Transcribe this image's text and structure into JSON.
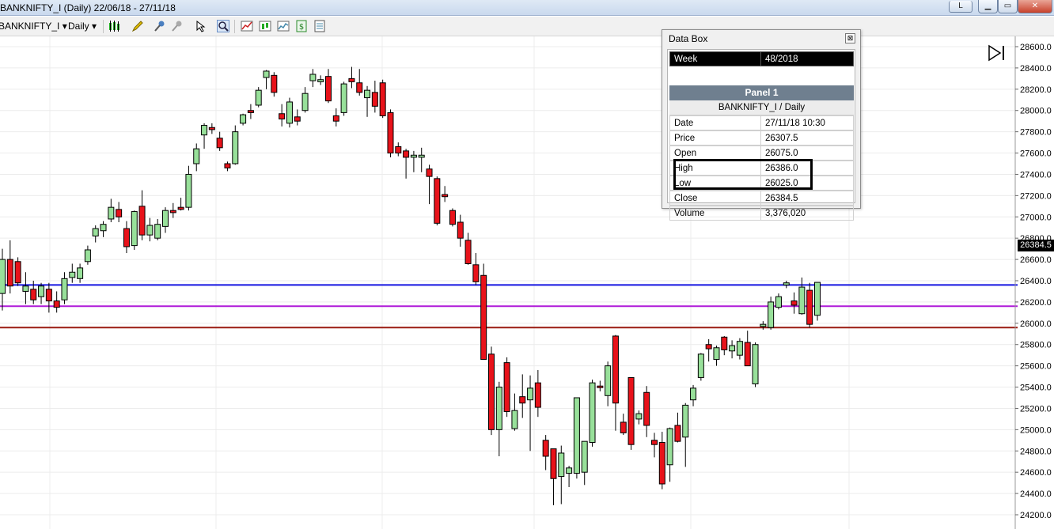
{
  "window": {
    "title": "BANKNIFTY_I (Daily)  22/06/18 - 27/11/18",
    "btn_l": "L",
    "btn_min": "▁",
    "btn_max": "▭",
    "btn_close": "✕"
  },
  "toolbar": {
    "instrument": "BANKNIFTY_I",
    "interval": "Daily",
    "dropdown_arrow": "▾",
    "icons": [
      "candle-style-icon",
      "draw-pencil-icon",
      "pin-icon",
      "magnet-icon",
      "cursor-icon",
      "zoom-icon",
      "indicators-icon",
      "strategies-icon",
      "chart-properties-icon",
      "dollar-icon",
      "data-box-icon"
    ]
  },
  "databox": {
    "title": "Data Box",
    "close": "⊠",
    "week_label": "Week",
    "week_value": "48/2018",
    "panel": "Panel 1",
    "instrument": "BANKNIFTY_I / Daily",
    "rows": [
      {
        "k": "Date",
        "v": "27/11/18 10:30"
      },
      {
        "k": "Price",
        "v": "26307.5"
      },
      {
        "k": "Open",
        "v": "26075.0"
      },
      {
        "k": "High",
        "v": "26386.0"
      },
      {
        "k": "Low",
        "v": "26025.0"
      },
      {
        "k": "Close",
        "v": "26384.5"
      },
      {
        "k": "Volume",
        "v": "3,376,020"
      }
    ]
  },
  "last_price_label": "26384.5",
  "colors": {
    "up": "#98e09a",
    "down": "#e8121a",
    "line_blue": "#1515e0",
    "line_purple": "#b01bd8",
    "line_red": "#9a1b12"
  },
  "chart_data": {
    "type": "candlestick",
    "ylim": [
      24100,
      28700
    ],
    "y_ticks": [
      "28600.0",
      "28400.0",
      "28200.0",
      "28000.0",
      "27800.0",
      "27600.0",
      "27400.0",
      "27200.0",
      "27000.0",
      "26800.0",
      "26600.0",
      "26400.0",
      "26200.0",
      "26000.0",
      "25800.0",
      "25600.0",
      "25400.0",
      "25200.0",
      "25000.0",
      "24800.0",
      "24600.0",
      "24400.0",
      "24200.0"
    ],
    "hlines": [
      {
        "y": 26360,
        "color": "#1515e0"
      },
      {
        "y": 26160,
        "color": "#b01bd8"
      },
      {
        "y": 25960,
        "color": "#9a1b12"
      }
    ],
    "candles": [
      {
        "o": 26280,
        "h": 26700,
        "l": 26120,
        "c": 26600
      },
      {
        "o": 26600,
        "h": 26780,
        "l": 26280,
        "c": 26350
      },
      {
        "o": 26580,
        "h": 26620,
        "l": 26350,
        "c": 26380
      },
      {
        "o": 26300,
        "h": 26480,
        "l": 26180,
        "c": 26350
      },
      {
        "o": 26320,
        "h": 26400,
        "l": 26180,
        "c": 26220
      },
      {
        "o": 26250,
        "h": 26380,
        "l": 26180,
        "c": 26350
      },
      {
        "o": 26320,
        "h": 26380,
        "l": 26100,
        "c": 26210
      },
      {
        "o": 26210,
        "h": 26300,
        "l": 26100,
        "c": 26150
      },
      {
        "o": 26220,
        "h": 26480,
        "l": 26180,
        "c": 26420
      },
      {
        "o": 26430,
        "h": 26560,
        "l": 26380,
        "c": 26480
      },
      {
        "o": 26420,
        "h": 26560,
        "l": 26380,
        "c": 26520
      },
      {
        "o": 26580,
        "h": 26730,
        "l": 26550,
        "c": 26690
      },
      {
        "o": 26820,
        "h": 26920,
        "l": 26760,
        "c": 26890
      },
      {
        "o": 26870,
        "h": 26960,
        "l": 26810,
        "c": 26930
      },
      {
        "o": 26980,
        "h": 27170,
        "l": 26950,
        "c": 27090
      },
      {
        "o": 27070,
        "h": 27140,
        "l": 26950,
        "c": 27000
      },
      {
        "o": 26890,
        "h": 26960,
        "l": 26660,
        "c": 26720
      },
      {
        "o": 26730,
        "h": 27060,
        "l": 26690,
        "c": 27050
      },
      {
        "o": 27100,
        "h": 27250,
        "l": 26780,
        "c": 26830
      },
      {
        "o": 26830,
        "h": 26990,
        "l": 26770,
        "c": 26920
      },
      {
        "o": 26800,
        "h": 26980,
        "l": 26780,
        "c": 26930
      },
      {
        "o": 26910,
        "h": 27090,
        "l": 26850,
        "c": 27060
      },
      {
        "o": 27060,
        "h": 27130,
        "l": 26990,
        "c": 27040
      },
      {
        "o": 27090,
        "h": 27180,
        "l": 27060,
        "c": 27070
      },
      {
        "o": 27090,
        "h": 27480,
        "l": 27060,
        "c": 27400
      },
      {
        "o": 27500,
        "h": 27690,
        "l": 27430,
        "c": 27640
      },
      {
        "o": 27770,
        "h": 27880,
        "l": 27640,
        "c": 27860
      },
      {
        "o": 27840,
        "h": 27880,
        "l": 27780,
        "c": 27820
      },
      {
        "o": 27740,
        "h": 27800,
        "l": 27620,
        "c": 27650
      },
      {
        "o": 27500,
        "h": 27520,
        "l": 27430,
        "c": 27460
      },
      {
        "o": 27500,
        "h": 27860,
        "l": 27490,
        "c": 27800
      },
      {
        "o": 27880,
        "h": 27970,
        "l": 27860,
        "c": 27960
      },
      {
        "o": 28000,
        "h": 28060,
        "l": 27920,
        "c": 27980
      },
      {
        "o": 28050,
        "h": 28220,
        "l": 28030,
        "c": 28190
      },
      {
        "o": 28310,
        "h": 28380,
        "l": 28200,
        "c": 28370
      },
      {
        "o": 28330,
        "h": 28360,
        "l": 28130,
        "c": 28170
      },
      {
        "o": 27970,
        "h": 28060,
        "l": 27850,
        "c": 27920
      },
      {
        "o": 27880,
        "h": 28120,
        "l": 27840,
        "c": 28080
      },
      {
        "o": 27940,
        "h": 28010,
        "l": 27860,
        "c": 27900
      },
      {
        "o": 28000,
        "h": 28220,
        "l": 27980,
        "c": 28160
      },
      {
        "o": 28280,
        "h": 28390,
        "l": 28220,
        "c": 28340
      },
      {
        "o": 28270,
        "h": 28330,
        "l": 28240,
        "c": 28290
      },
      {
        "o": 28320,
        "h": 28390,
        "l": 28070,
        "c": 28090
      },
      {
        "o": 27950,
        "h": 28020,
        "l": 27850,
        "c": 27900
      },
      {
        "o": 27980,
        "h": 28270,
        "l": 27950,
        "c": 28250
      },
      {
        "o": 28300,
        "h": 28410,
        "l": 28210,
        "c": 28270
      },
      {
        "o": 28260,
        "h": 28390,
        "l": 28140,
        "c": 28170
      },
      {
        "o": 28120,
        "h": 28230,
        "l": 27940,
        "c": 28190
      },
      {
        "o": 28170,
        "h": 28280,
        "l": 27980,
        "c": 28040
      },
      {
        "o": 28260,
        "h": 28290,
        "l": 27930,
        "c": 27950
      },
      {
        "o": 27980,
        "h": 28010,
        "l": 27560,
        "c": 27600
      },
      {
        "o": 27660,
        "h": 27700,
        "l": 27570,
        "c": 27600
      },
      {
        "o": 27620,
        "h": 27640,
        "l": 27360,
        "c": 27560
      },
      {
        "o": 27560,
        "h": 27620,
        "l": 27420,
        "c": 27580
      },
      {
        "o": 27560,
        "h": 27650,
        "l": 27420,
        "c": 27580
      },
      {
        "o": 27450,
        "h": 27490,
        "l": 27120,
        "c": 27380
      },
      {
        "o": 27360,
        "h": 27380,
        "l": 26920,
        "c": 26940
      },
      {
        "o": 27210,
        "h": 27290,
        "l": 27140,
        "c": 27190
      },
      {
        "o": 27060,
        "h": 27080,
        "l": 26910,
        "c": 26930
      },
      {
        "o": 26950,
        "h": 27020,
        "l": 26720,
        "c": 26800
      },
      {
        "o": 26780,
        "h": 26850,
        "l": 26550,
        "c": 26560
      },
      {
        "o": 26550,
        "h": 26660,
        "l": 26360,
        "c": 26390
      },
      {
        "o": 26450,
        "h": 26560,
        "l": 25850,
        "c": 25660
      },
      {
        "o": 25710,
        "h": 25780,
        "l": 24950,
        "c": 25000
      },
      {
        "o": 25000,
        "h": 25450,
        "l": 24750,
        "c": 25400
      },
      {
        "o": 25630,
        "h": 25680,
        "l": 25120,
        "c": 25170
      },
      {
        "o": 25010,
        "h": 25340,
        "l": 24990,
        "c": 25180
      },
      {
        "o": 25310,
        "h": 25520,
        "l": 25110,
        "c": 25250
      },
      {
        "o": 25280,
        "h": 25510,
        "l": 24800,
        "c": 25390
      },
      {
        "o": 25440,
        "h": 25560,
        "l": 25120,
        "c": 25210
      },
      {
        "o": 24900,
        "h": 24950,
        "l": 24620,
        "c": 24750
      },
      {
        "o": 24820,
        "h": 24820,
        "l": 24290,
        "c": 24540
      },
      {
        "o": 24560,
        "h": 24850,
        "l": 24300,
        "c": 24780
      },
      {
        "o": 24590,
        "h": 24660,
        "l": 24460,
        "c": 24640
      },
      {
        "o": 24590,
        "h": 24920,
        "l": 24540,
        "c": 25300
      },
      {
        "o": 24600,
        "h": 24870,
        "l": 24480,
        "c": 24890
      },
      {
        "o": 24880,
        "h": 25470,
        "l": 24840,
        "c": 25440
      },
      {
        "o": 25410,
        "h": 25460,
        "l": 25360,
        "c": 25400
      },
      {
        "o": 25320,
        "h": 25640,
        "l": 25220,
        "c": 25600
      },
      {
        "o": 25880,
        "h": 25890,
        "l": 24990,
        "c": 25250
      },
      {
        "o": 25070,
        "h": 25150,
        "l": 24950,
        "c": 24970
      },
      {
        "o": 25490,
        "h": 25490,
        "l": 24810,
        "c": 24860
      },
      {
        "o": 25100,
        "h": 25180,
        "l": 25050,
        "c": 25150
      },
      {
        "o": 25350,
        "h": 25410,
        "l": 24930,
        "c": 25040
      },
      {
        "o": 24900,
        "h": 24970,
        "l": 24740,
        "c": 24860
      },
      {
        "o": 24880,
        "h": 24980,
        "l": 24440,
        "c": 24490
      },
      {
        "o": 24670,
        "h": 25020,
        "l": 24510,
        "c": 25010
      },
      {
        "o": 25040,
        "h": 25160,
        "l": 24880,
        "c": 24890
      },
      {
        "o": 24930,
        "h": 25250,
        "l": 24650,
        "c": 25230
      },
      {
        "o": 25280,
        "h": 25420,
        "l": 25220,
        "c": 25390
      },
      {
        "o": 25490,
        "h": 25720,
        "l": 25460,
        "c": 25710
      },
      {
        "o": 25800,
        "h": 25850,
        "l": 25640,
        "c": 25760
      },
      {
        "o": 25660,
        "h": 25790,
        "l": 25600,
        "c": 25770
      },
      {
        "o": 25870,
        "h": 25880,
        "l": 25700,
        "c": 25750
      },
      {
        "o": 25740,
        "h": 25840,
        "l": 25670,
        "c": 25790
      },
      {
        "o": 25700,
        "h": 25860,
        "l": 25660,
        "c": 25830
      },
      {
        "o": 25820,
        "h": 25930,
        "l": 25600,
        "c": 25600
      },
      {
        "o": 25430,
        "h": 25820,
        "l": 25400,
        "c": 25800
      },
      {
        "o": 25970,
        "h": 26020,
        "l": 25940,
        "c": 25990
      },
      {
        "o": 25960,
        "h": 26250,
        "l": 25940,
        "c": 26200
      },
      {
        "o": 26150,
        "h": 26280,
        "l": 26130,
        "c": 26250
      },
      {
        "o": 26360,
        "h": 26400,
        "l": 26330,
        "c": 26380
      },
      {
        "o": 26210,
        "h": 26290,
        "l": 26090,
        "c": 26170
      },
      {
        "o": 26090,
        "h": 26430,
        "l": 26080,
        "c": 26340
      },
      {
        "o": 26310,
        "h": 26380,
        "l": 25960,
        "c": 25990
      },
      {
        "o": 26075,
        "h": 26386,
        "l": 26025,
        "c": 26384.5
      }
    ]
  }
}
